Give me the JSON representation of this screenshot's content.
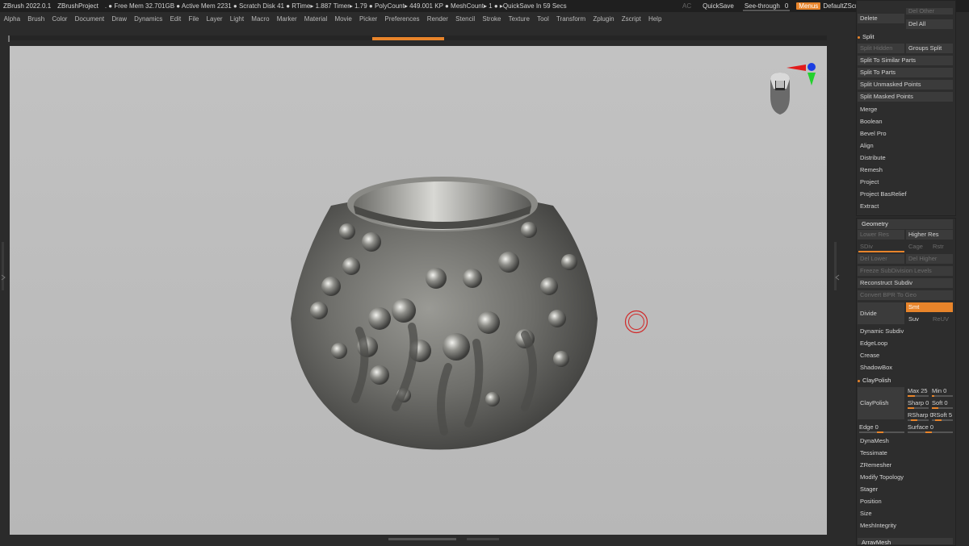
{
  "titlebar": {
    "app": "ZBrush 2022.0.1",
    "project": "ZBrushProject",
    "info": ". ● Free Mem 32.701GB ● Active Mem 2231 ● Scratch Disk 41 ●  RTime▸ 1.887 Timer▸ 1.79 ● PolyCount▸ 449.001 KP  ● MeshCount▸ 1  ●  ▸QuickSave In 59 Secs",
    "ac": "AC",
    "quicksave": "QuickSave",
    "seethrough_label": "See-through",
    "seethrough_value": "0",
    "menus": "Menus",
    "script": "DefaultZScript"
  },
  "menubar": [
    "Alpha",
    "Brush",
    "Color",
    "Document",
    "Draw",
    "Dynamics",
    "Edit",
    "File",
    "Layer",
    "Light",
    "Macro",
    "Marker",
    "Material",
    "Movie",
    "Picker",
    "Preferences",
    "Render",
    "Stencil",
    "Stroke",
    "Texture",
    "Tool",
    "Transform",
    "Zplugin",
    "Zscript",
    "Help"
  ],
  "split_section": {
    "top_buttons": {
      "delete": "Delete",
      "del_other": "Del Other",
      "del_all": "Del All"
    },
    "header": "Split",
    "split_hidden": "Split Hidden",
    "groups_split": "Groups Split",
    "items": [
      "Split To Similar Parts",
      "Split To Parts",
      "Split Unmasked Points",
      "Split Masked Points"
    ],
    "plain_items": [
      "Merge",
      "Boolean",
      "Bevel Pro",
      "Align",
      "Distribute",
      "Remesh",
      "Project",
      "Project BasRelief",
      "Extract"
    ]
  },
  "geometry": {
    "header": "Geometry",
    "lower_res": "Lower Res",
    "higher_res": "Higher Res",
    "sdiv": "SDiv",
    "cage": "Cage",
    "rstr": "Rstr",
    "del_lower": "Del Lower",
    "del_higher": "Del Higher",
    "freeze": "Freeze SubDivision Levels",
    "reconstruct": "Reconstruct Subdiv",
    "convert": "Convert BPR To Geo",
    "divide": "Divide",
    "smt": "Smt",
    "suv": "Suv",
    "reuv": "ReUV",
    "plain_items": [
      "Dynamic Subdiv",
      "EdgeLoop",
      "Crease",
      "ShadowBox"
    ],
    "claypolish_header": "ClayPolish",
    "claypolish_btn": "ClayPolish",
    "sliders": {
      "max": "Max 25",
      "min": "Min 0",
      "sharp": "Sharp 0",
      "soft": "Soft 0",
      "rsharp": "RSharp 0",
      "rsoft": "RSoft 5",
      "edge": "Edge 0",
      "surface": "Surface 0"
    },
    "bottom_items": [
      "DynaMesh",
      "Tessimate",
      "ZRemesher",
      "Modify Topology",
      "Stager",
      "Position",
      "Size",
      "MeshIntegrity"
    ],
    "arraymesh": "ArrayMesh"
  },
  "colors": {
    "accent": "#e8842a",
    "viewport": "#bdbdbd",
    "panel": "#2b2b2b"
  }
}
